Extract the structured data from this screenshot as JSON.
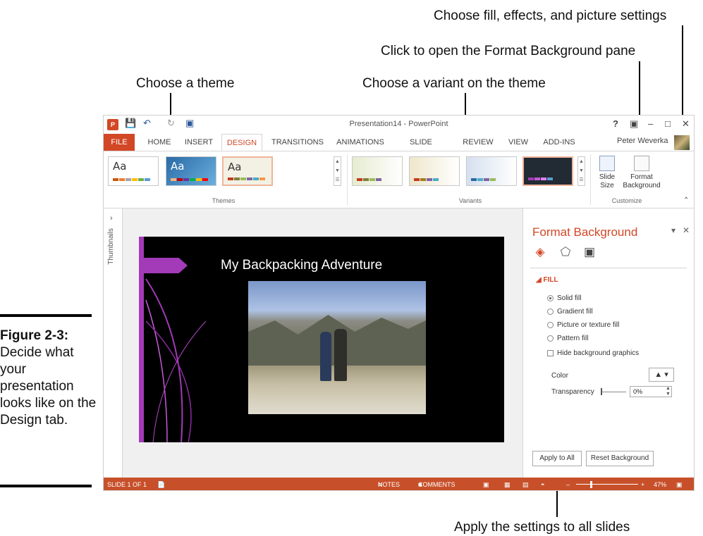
{
  "callouts": {
    "fill_effects": "Choose fill, effects, and picture settings",
    "open_pane": "Click to open the Format Background pane",
    "theme": "Choose a theme",
    "variant": "Choose a variant on the theme",
    "apply_all": "Apply the settings to all slides"
  },
  "caption": {
    "label": "Figure 2-3:",
    "text": "Decide what your presentation looks like on the Design tab."
  },
  "window": {
    "title": "Presentation14 - PowerPoint",
    "app_icon": "P",
    "user": "Peter Weverka",
    "help": "?",
    "tabs": {
      "file": "FILE",
      "home": "HOME",
      "insert": "INSERT",
      "design": "DESIGN",
      "transitions": "TRANSITIONS",
      "animations": "ANIMATIONS",
      "slideshow": "SLIDE SHOW",
      "review": "REVIEW",
      "view": "VIEW",
      "addins": "ADD-INS"
    }
  },
  "ribbon": {
    "themes": [
      {
        "label": "Aa",
        "bg": "#ffffff",
        "fg": "#333333"
      },
      {
        "label": "Aa",
        "bg": "#3d7fb8",
        "fg": "#ffffff"
      },
      {
        "label": "Aa",
        "bg": "#f3f1e4",
        "fg": "#333333"
      }
    ],
    "themes_label": "Themes",
    "variants_label": "Variants",
    "customize_label": "Customize",
    "slide_size": "Slide Size",
    "format_background": "Format Background"
  },
  "thumbnails_label": "Thumbnails",
  "slide": {
    "title": "My Backpacking Adventure"
  },
  "pane": {
    "title": "Format Background",
    "fill_header": "FILL",
    "options": {
      "solid": "Solid fill",
      "gradient": "Gradient fill",
      "picture": "Picture or texture fill",
      "pattern": "Pattern fill"
    },
    "hide_bg": "Hide background graphics",
    "color_label": "Color",
    "transparency_label": "Transparency",
    "transparency_value": "0%",
    "apply_to_all": "Apply to All",
    "reset_background": "Reset Background"
  },
  "status": {
    "slide_info": "SLIDE 1 OF 1",
    "notes": "NOTES",
    "comments": "COMMENTS",
    "zoom": "47%"
  },
  "colors": {
    "accent": "#d24726",
    "slide_accent": "#a33ab8"
  }
}
